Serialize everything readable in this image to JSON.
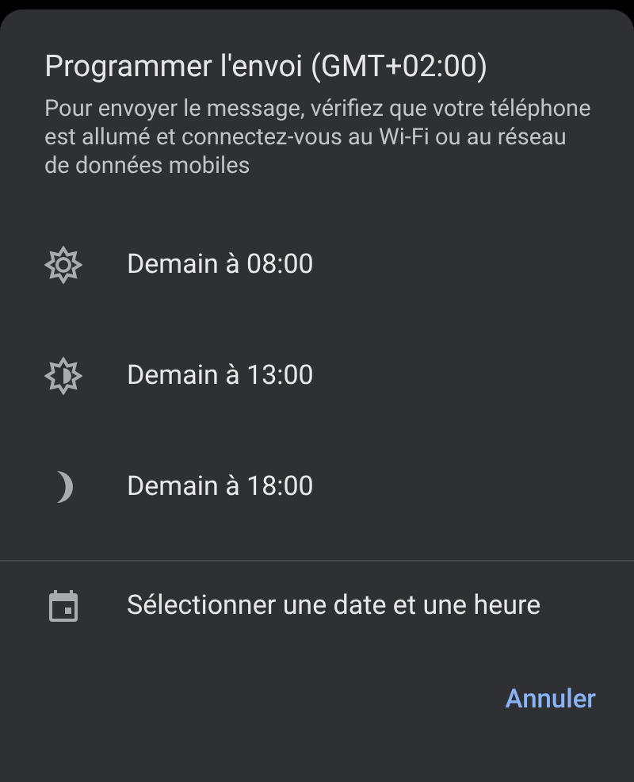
{
  "dialog": {
    "title": "Programmer l'envoi (GMT+02:00)",
    "message": "Pour envoyer le message, vérifiez que votre téléphone est allumé et connectez-vous au Wi-Fi ou au réseau de données mobiles",
    "options": [
      {
        "kind": "morning",
        "label": "Demain à 08:00"
      },
      {
        "kind": "afternoon",
        "label": "Demain à 13:00"
      },
      {
        "kind": "evening",
        "label": "Demain à 18:00"
      }
    ],
    "custom_option": {
      "kind": "calendar",
      "label": "Sélectionner une date et une heure"
    },
    "buttons": [
      "Annuler"
    ]
  }
}
